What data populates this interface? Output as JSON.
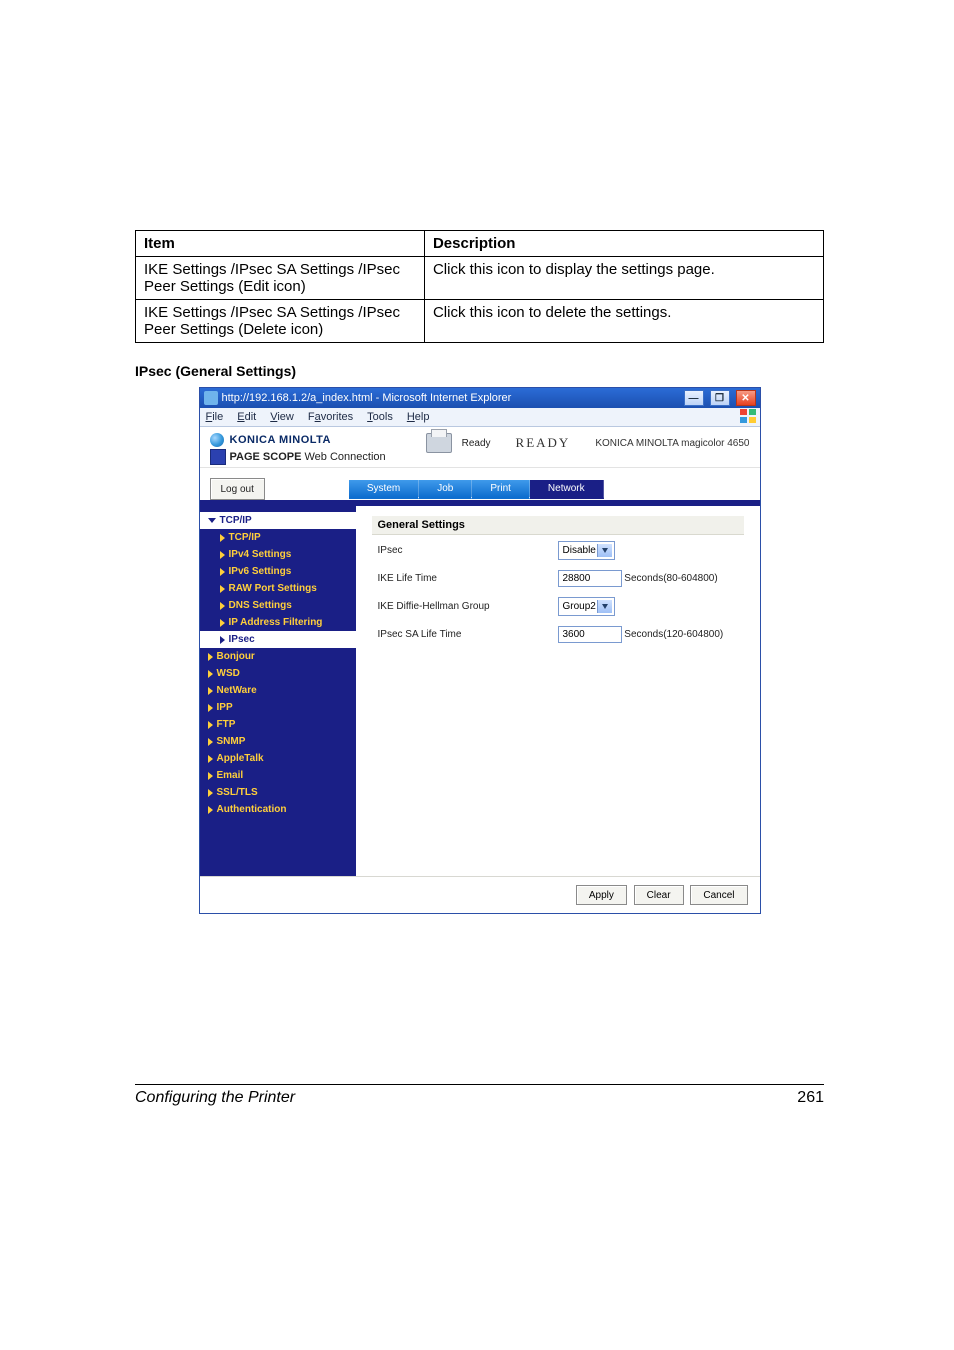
{
  "table": {
    "headers": {
      "item": "Item",
      "desc": "Description"
    },
    "rows": [
      {
        "item": "IKE Settings /IPsec SA Settings /IPsec Peer Settings (Edit icon)",
        "desc": "Click this icon to display the settings page."
      },
      {
        "item": "IKE Settings /IPsec SA Settings /IPsec Peer Settings (Delete icon)",
        "desc": "Click this icon to delete the settings."
      }
    ]
  },
  "section_heading": "IPsec (General Settings)",
  "window": {
    "title": "http://192.168.1.2/a_index.html - Microsoft Internet Explorer",
    "btn_min": "—",
    "btn_max": "❐",
    "btn_close": "✕"
  },
  "menubar": {
    "file": "File",
    "edit": "Edit",
    "view": "View",
    "favorites": "Favorites",
    "tools": "Tools",
    "help": "Help"
  },
  "header": {
    "brand": "KONICA MINOLTA",
    "pagescope_prefix": "PAGE SCOPE",
    "pagescope_suffix": "Web Connection",
    "ready_small": "Ready",
    "ready_big": "READY",
    "model": "KONICA MINOLTA magicolor 4650"
  },
  "logout": "Log out",
  "tabs": {
    "system": "System",
    "job": "Job",
    "print": "Print",
    "network": "Network"
  },
  "sidebar": {
    "tcpip": "TCP/IP",
    "tcpip_sub": "TCP/IP",
    "ipv4": "IPv4 Settings",
    "ipv6": "IPv6 Settings",
    "rawport": "RAW Port Settings",
    "dns": "DNS Settings",
    "ipfilter": "IP Address Filtering",
    "ipsec": "IPsec",
    "bonjour": "Bonjour",
    "wsd": "WSD",
    "netware": "NetWare",
    "ipp": "IPP",
    "ftp": "FTP",
    "snmp": "SNMP",
    "appletalk": "AppleTalk",
    "email": "Email",
    "ssltls": "SSL/TLS",
    "auth": "Authentication"
  },
  "content": {
    "heading": "General Settings",
    "labels": {
      "ipsec": "IPsec",
      "ike_life": "IKE Life Time",
      "ike_dh": "IKE Diffie-Hellman Group",
      "sa_life": "IPsec SA Life Time"
    },
    "values": {
      "ipsec_sel": "Disable",
      "ike_life_val": "28800",
      "ike_life_hint": "Seconds(80-604800)",
      "dh_sel": "Group2",
      "sa_life_val": "3600",
      "sa_life_hint": "Seconds(120-604800)"
    }
  },
  "buttons": {
    "apply": "Apply",
    "clear": "Clear",
    "cancel": "Cancel"
  },
  "footer": {
    "title": "Configuring the Printer",
    "page": "261"
  }
}
